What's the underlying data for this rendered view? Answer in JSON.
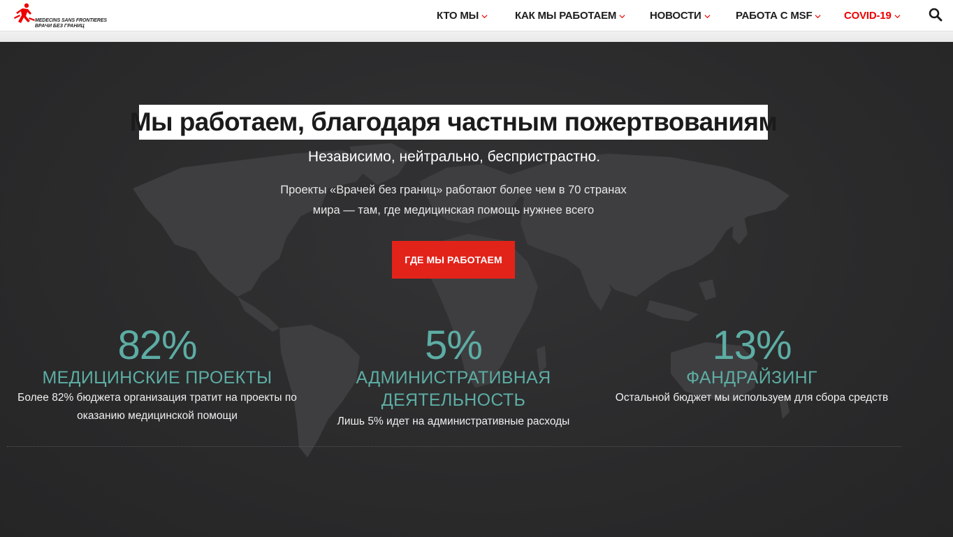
{
  "header": {
    "logo": {
      "line1": "MEDECINS SANS FRONTIERES",
      "line2": "ВРАЧИ БЕЗ ГРАНИЦ",
      "logo_color": "#ee0000"
    },
    "nav": [
      {
        "label": "КТО МЫ"
      },
      {
        "label": "КАК МЫ РАБОТАЕМ"
      },
      {
        "label": "НОВОСТИ"
      },
      {
        "label": "РАБОТА С MSF"
      },
      {
        "label": "COVID-19"
      }
    ],
    "search_icon": "search-icon"
  },
  "hero": {
    "title": "Мы работаем, благодаря частным пожертвованиям",
    "subtitle": "Независимо, нейтрально, беспристрастно.",
    "description": "Проекты «Врачей без границ» работают более чем в 70 странах мира — там, где медицинская помощь нужнее всего",
    "cta_label": "ГДЕ МЫ РАБОТАЕМ",
    "cta_color": "#e2231a"
  },
  "stats": [
    {
      "value": "82%",
      "label": "МЕДИЦИНСКИЕ ПРОЕКТЫ",
      "desc": "Более 82% бюджета организация тратит на проекты по оказанию медицинской помощи"
    },
    {
      "value": "5%",
      "label": "АДМИНИСТРАТИВНАЯ ДЕЯТЕЛЬНОСТЬ",
      "desc": "Лишь 5% идет на административные расходы"
    },
    {
      "value": "13%",
      "label": "ФАНДРАЙЗИНГ",
      "desc": "Остальной бюджет мы используем для сбора средств"
    }
  ],
  "colors": {
    "accent_teal": "#5dada4",
    "brand_red": "#e2231a",
    "background": "#2b2b2c"
  }
}
